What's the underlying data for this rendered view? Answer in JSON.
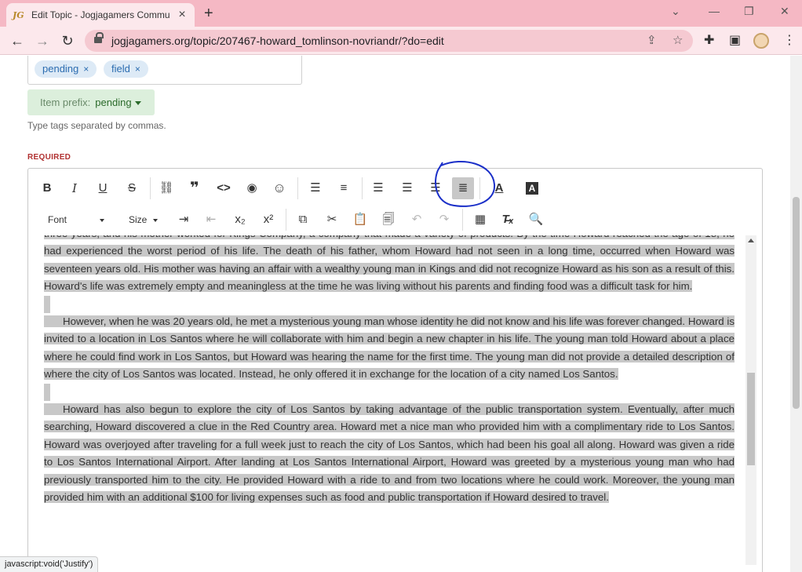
{
  "browser": {
    "tab_favicon": "JG",
    "tab_title": "Edit Topic - Jogjagamers Commu",
    "tab_close": "×",
    "new_tab": "+",
    "url": "jogjagamers.org/topic/207467-howard_tomlinson-novriandr/?do=edit",
    "status_text": "javascript:void('Justify')"
  },
  "tags": {
    "items": [
      {
        "label": "pending",
        "remove": "×"
      },
      {
        "label": "field",
        "remove": "×"
      }
    ],
    "prefix_label": "Item prefix:",
    "prefix_value": "pending",
    "hint": "Type tags separated by commas."
  },
  "editor": {
    "required_label": "REQUIRED",
    "font_label": "Font",
    "size_label": "Size",
    "paragraphs": {
      "p1": "three years, and his mother worked for Kings Company, a company that made a variety of products. By the time Howard reached the age of 18, he had experienced the worst period of his life. The death of his father, whom Howard had not seen in a long time, occurred when Howard was seventeen years old. His mother was having an affair with a wealthy young man in Kings and did not recognize Howard as his son as a result of this. Howard's life was extremely empty and meaningless at the time he was living without his parents and finding food was a difficult task for him.",
      "p2": "However, when he was 20 years old, he met a mysterious young man whose identity he did not know and his life was forever changed. Howard is invited to a location in Los Santos where he will collaborate with him and begin a new chapter in his life. The young man told Howard about a place where he could find work in Los Santos, but Howard was hearing the name for the first time. The young man did not provide a detailed description of where the city of Los Santos was located. Instead, he only offered it in exchange for the location of a city named Los Santos.",
      "p3": "Howard has also begun to explore the city of Los Santos by taking advantage of the public transportation system. Eventually, after much searching, Howard discovered a clue in the Red Country area. Howard met a nice man who provided him with a complimentary ride to Los Santos. Howard was overjoyed after traveling for a full week just to reach the city of Los Santos, which had been his goal all along. Howard was given a ride to Los Santos International Airport. After landing at Los Santos International Airport, Howard was greeted by a mysterious young man who had previously transported him to the city. He provided Howard with a ride to and from two locations where he could work. Moreover, the young man provided him with an additional $100 for living expenses such as food and public transportation if Howard desired to travel."
    }
  },
  "colors": {
    "tabbar": "#f5b8c4",
    "selection": "#c8c8c8",
    "annotation": "#1a2fc8"
  }
}
